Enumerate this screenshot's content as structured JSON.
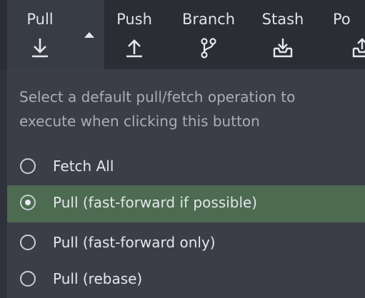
{
  "toolbar": {
    "buttons": [
      {
        "label": "Pull",
        "icon": "pull-arrow-down-icon"
      },
      {
        "label": "Push",
        "icon": "push-arrow-up-icon"
      },
      {
        "label": "Branch",
        "icon": "branch-icon"
      },
      {
        "label": "Stash",
        "icon": "stash-tray-icon"
      },
      {
        "label": "Po",
        "icon": "pop-tray-icon"
      }
    ]
  },
  "dropdown": {
    "prompt": "Select a default pull/fetch operation to execute when clicking this button",
    "options": [
      {
        "label": "Fetch All",
        "selected": false
      },
      {
        "label": "Pull (fast-forward if possible)",
        "selected": true
      },
      {
        "label": "Pull (fast-forward only)",
        "selected": false
      },
      {
        "label": "Pull (rebase)",
        "selected": false
      }
    ]
  },
  "colors": {
    "toolbar_bg": "#2a2d34",
    "panel_bg": "#3b3e48",
    "selected_bg": "#4c6b50",
    "text": "#e4e6ea",
    "muted_text": "#a9adb7"
  }
}
